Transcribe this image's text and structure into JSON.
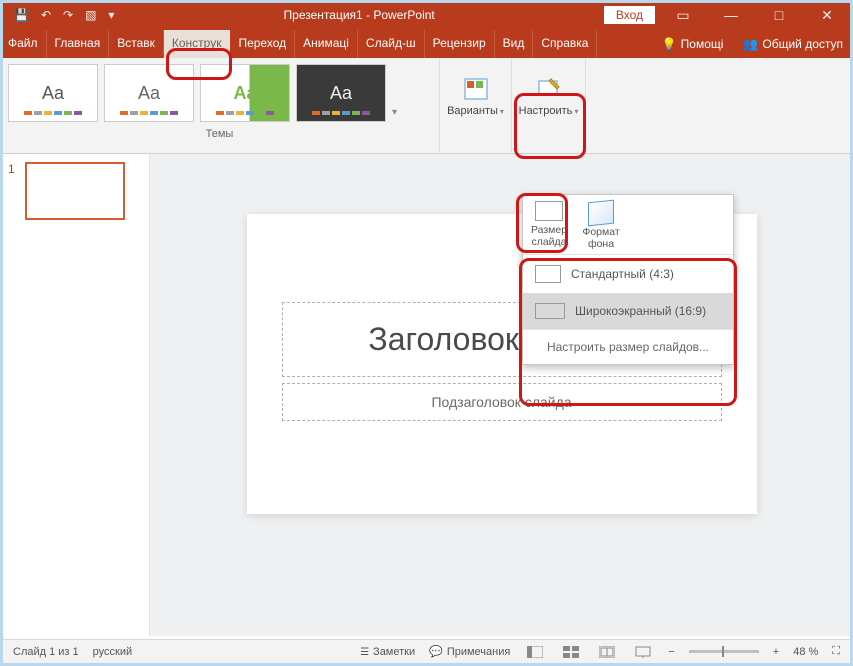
{
  "titlebar": {
    "title": "Презентация1 - PowerPoint",
    "signin": "Вход"
  },
  "tabs": {
    "file": "Файл",
    "home": "Главная",
    "insert": "Вставк",
    "design": "Конструк",
    "transitions": "Переход",
    "animations": "Анимаці",
    "slideshow": "Слайд-ш",
    "review": "Рецензир",
    "view": "Вид",
    "help": "Справка",
    "tellme": "Помощі",
    "share": "Общий доступ"
  },
  "ribbon": {
    "themes_label": "Темы",
    "variants": "Варианты",
    "customize": "Настроить"
  },
  "dropdown": {
    "slide_size": "Размер слайда",
    "bg_format": "Формат фона",
    "standard": "Стандартный (4:3)",
    "widescreen": "Широкоэкранный (16:9)",
    "custom": "Настроить размер слайдов..."
  },
  "slide": {
    "title_placeholder": "Заголовок слайда",
    "subtitle_placeholder": "Подзаголовок слайда"
  },
  "thumbs": {
    "n1": "1"
  },
  "status": {
    "slide_of": "Слайд 1 из 1",
    "lang": "русский",
    "notes": "Заметки",
    "comments": "Примечания",
    "zoom": "48 %"
  },
  "theme_aa": "Aa",
  "colors": {
    "stripe": [
      "#e06c2a",
      "#a0a0a0",
      "#f0b030",
      "#5a9bd4",
      "#7ab84a",
      "#8a5aa0"
    ]
  }
}
